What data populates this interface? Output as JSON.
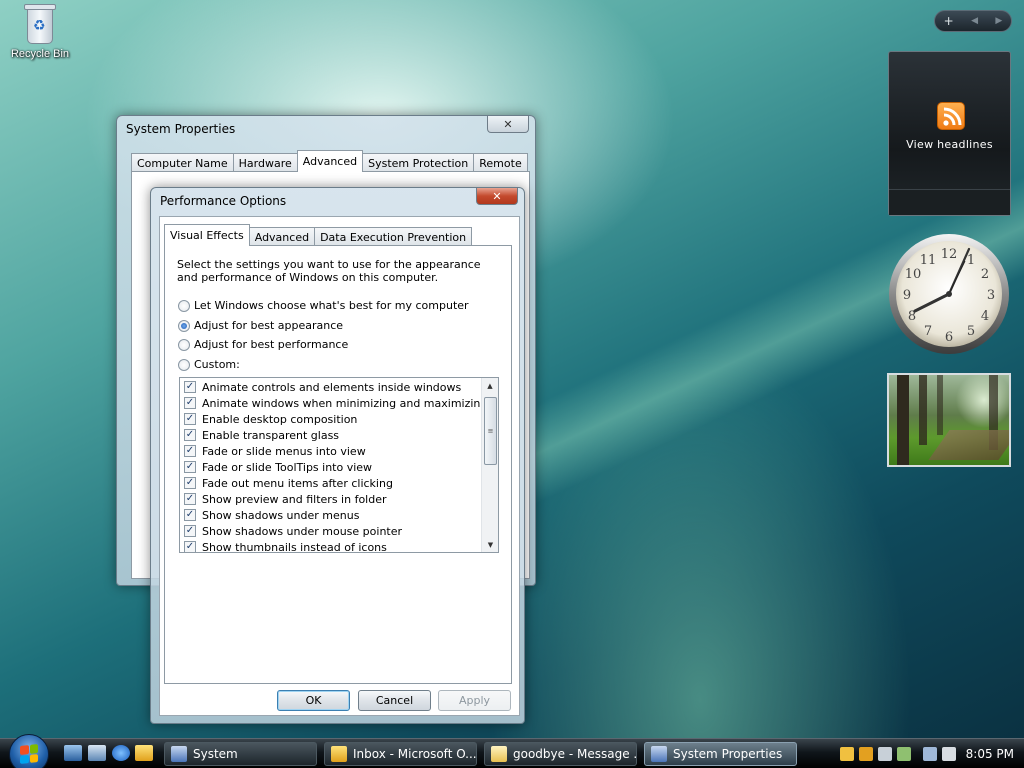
{
  "desktop": {
    "recycle_bin_label": "Recycle Bin"
  },
  "sidebar": {
    "add_glyph": "+",
    "prev_glyph": "◀",
    "next_glyph": "▶",
    "feed_headlines_label": "View headlines"
  },
  "system_properties": {
    "title": "System Properties",
    "tabs": [
      {
        "label": "Computer Name"
      },
      {
        "label": "Hardware"
      },
      {
        "label": "Advanced"
      },
      {
        "label": "System Protection"
      },
      {
        "label": "Remote"
      }
    ],
    "active_tab": "Advanced"
  },
  "performance_options": {
    "title": "Performance Options",
    "tabs": [
      {
        "label": "Visual Effects"
      },
      {
        "label": "Advanced"
      },
      {
        "label": "Data Execution Prevention"
      }
    ],
    "active_tab": "Visual Effects",
    "description": "Select the settings you want to use for the appearance and performance of Windows on this computer.",
    "options": [
      {
        "label": "Let Windows choose what's best for my computer",
        "selected": false
      },
      {
        "label": "Adjust for best appearance",
        "selected": true
      },
      {
        "label": "Adjust for best performance",
        "selected": false
      },
      {
        "label": "Custom:",
        "selected": false
      }
    ],
    "effects": [
      {
        "label": "Animate controls and elements inside windows",
        "checked": true
      },
      {
        "label": "Animate windows when minimizing and maximizing",
        "checked": true
      },
      {
        "label": "Enable desktop composition",
        "checked": true
      },
      {
        "label": "Enable transparent glass",
        "checked": true
      },
      {
        "label": "Fade or slide menus into view",
        "checked": true
      },
      {
        "label": "Fade or slide ToolTips into view",
        "checked": true
      },
      {
        "label": "Fade out menu items after clicking",
        "checked": true
      },
      {
        "label": "Show preview and filters in folder",
        "checked": true
      },
      {
        "label": "Show shadows under menus",
        "checked": true
      },
      {
        "label": "Show shadows under mouse pointer",
        "checked": true
      },
      {
        "label": "Show thumbnails instead of icons",
        "checked": true
      }
    ],
    "buttons": {
      "ok": "OK",
      "cancel": "Cancel",
      "apply": "Apply"
    }
  },
  "taskbar": {
    "items": [
      {
        "label": "System",
        "icon": "system-icon"
      },
      {
        "label": "Inbox - Microsoft O...",
        "icon": "mail-icon"
      },
      {
        "label": "goodbye - Message ...",
        "icon": "message-icon"
      },
      {
        "label": "System Properties",
        "icon": "system-properties-icon"
      }
    ],
    "active_item": "System Properties",
    "clock": "8:05 PM"
  },
  "colors": {
    "accent": "#1f5fb8",
    "close_red": "#c44a2e"
  }
}
